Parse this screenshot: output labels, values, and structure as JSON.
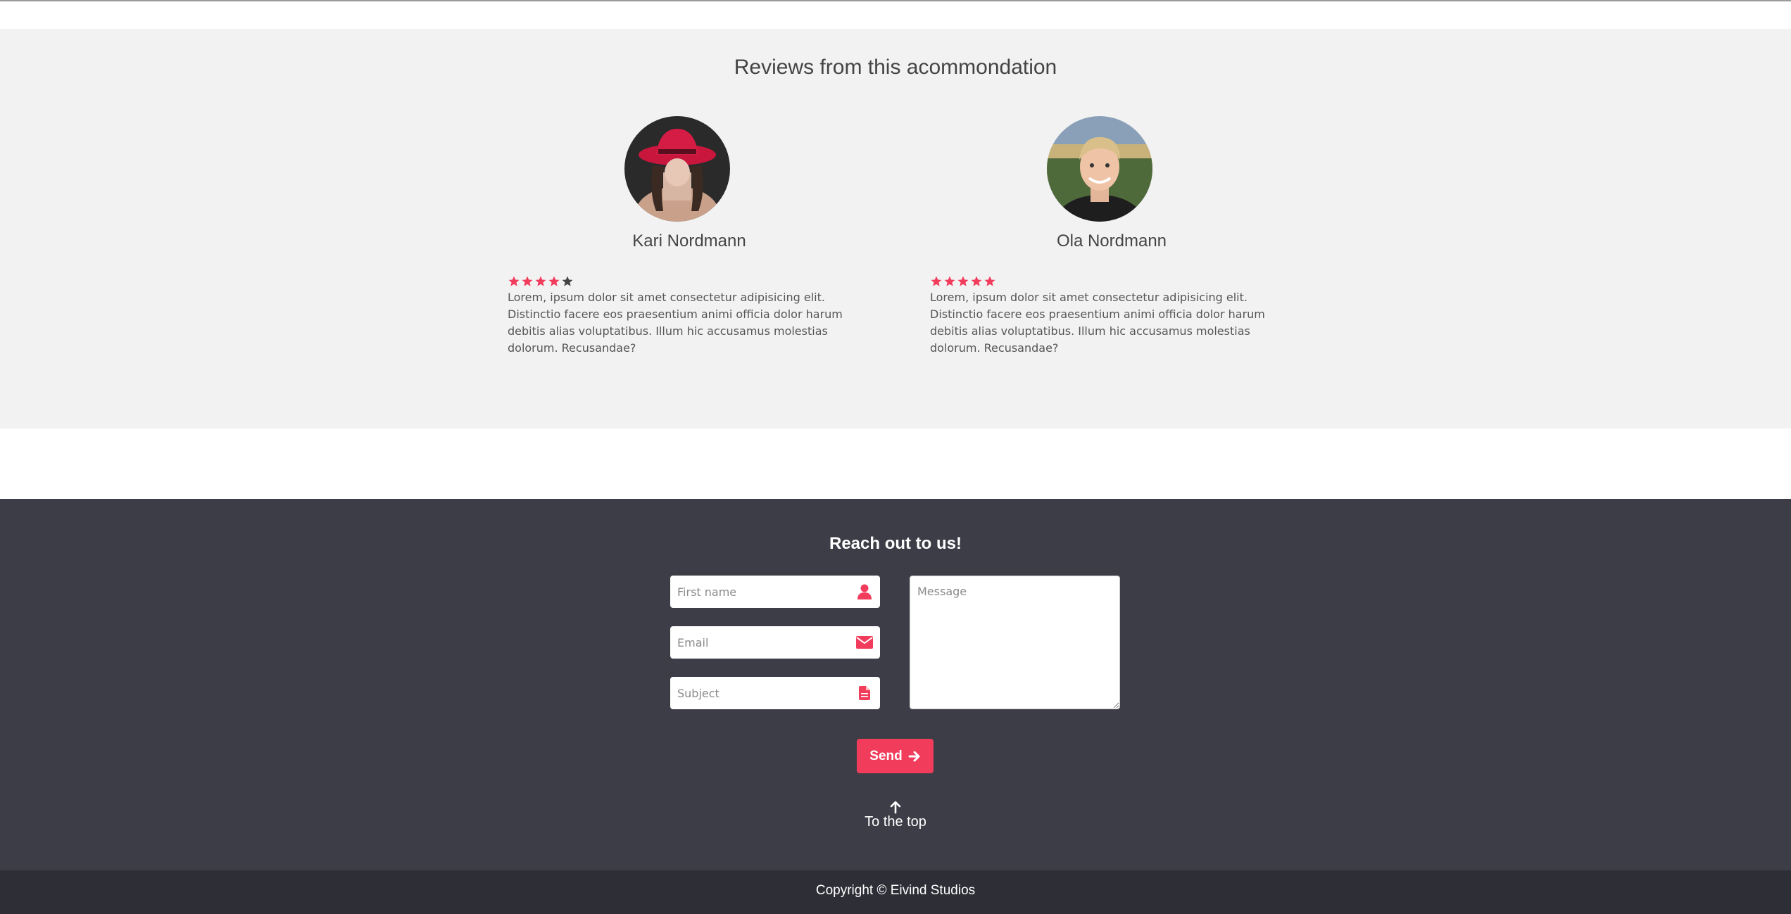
{
  "reviews": {
    "title": "Reviews from this acommondation",
    "items": [
      {
        "name": "Kari Nordmann",
        "rating": 4,
        "max_rating": 5,
        "text": "Lorem, ipsum dolor sit amet consectetur adipisicing elit. Distinctio facere eos praesentium animi officia dolor harum debitis alias voluptatibus. Illum hic accusamus molestias dolorum. Recusandae?"
      },
      {
        "name": "Ola Nordmann",
        "rating": 5,
        "max_rating": 5,
        "text": "Lorem, ipsum dolor sit amet consectetur adipisicing elit. Distinctio facere eos praesentium animi officia dolor harum debitis alias voluptatibus. Illum hic accusamus molestias dolorum. Recusandae?"
      }
    ]
  },
  "contact": {
    "title": "Reach out to us!",
    "first_name_placeholder": "First name",
    "email_placeholder": "Email",
    "subject_placeholder": "Subject",
    "message_placeholder": "Message",
    "send_label": "Send",
    "to_top_label": "To the top"
  },
  "footer": {
    "copyright": "Copyright © Eivind Studios"
  },
  "icons": {
    "first_name": "user-icon",
    "email": "envelope-icon",
    "subject": "document-icon",
    "send": "arrow-right-icon",
    "to_top": "arrow-up-icon",
    "star": "star-icon"
  },
  "colors": {
    "accent": "#f23c5c",
    "star_filled": "#f23c5c",
    "star_empty": "#444444",
    "footer_bg": "#3d3d47",
    "bottom_bar_bg": "#2e2e36",
    "reviews_bg": "#f2f2f2"
  }
}
